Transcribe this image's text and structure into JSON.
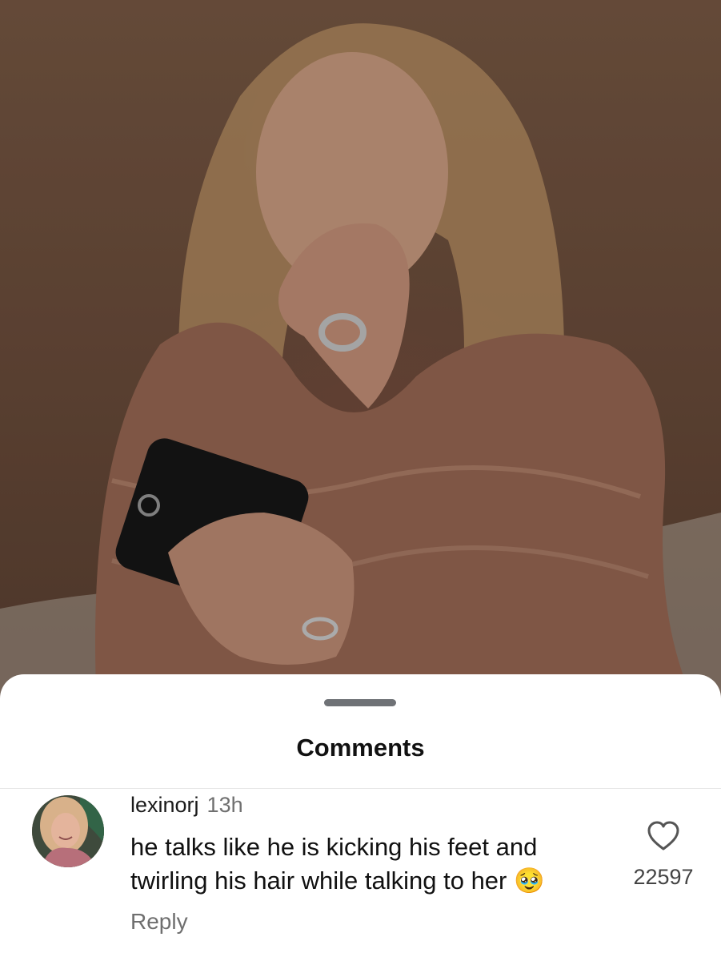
{
  "sheet": {
    "title": "Comments"
  },
  "comment": {
    "username": "lexinorj",
    "timestamp": "13h",
    "text": "he talks like he is kicking his feet and twirling his hair while talking to her 🥹",
    "reply_label": "Reply",
    "like_count": "22597"
  },
  "icons": {
    "like": "heart-outline-icon",
    "avatar": "user-avatar"
  },
  "colors": {
    "sheet_background": "#ffffff",
    "handle": "#6f7276",
    "secondary_text": "#6f6f6f"
  }
}
